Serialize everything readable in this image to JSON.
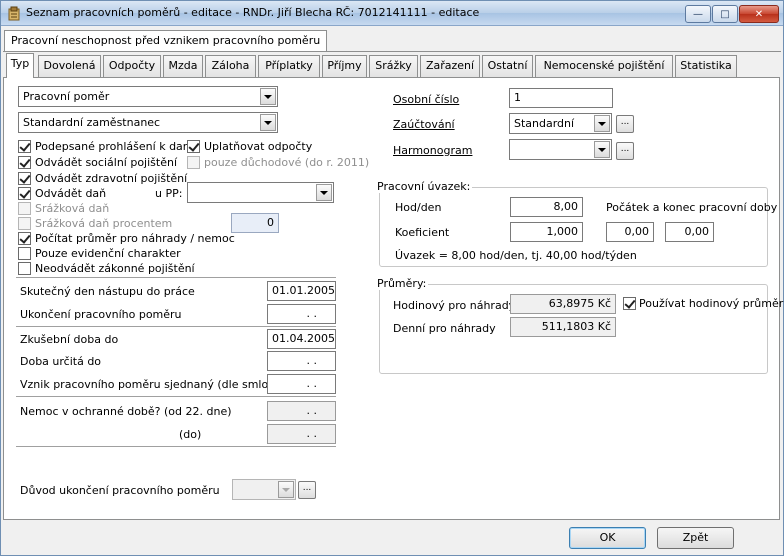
{
  "window": {
    "title": "Seznam pracovních poměrů - editace - RNDr. Jiří Blecha  RČ: 7012141111 - editace",
    "min_glyph": "—",
    "max_glyph": "□",
    "close_glyph": "✕"
  },
  "top_tab": {
    "label": "Pracovní neschopnost před vznikem pracovního poměru"
  },
  "tabs": [
    "Typ",
    "Dovolená",
    "Odpočty",
    "Mzda",
    "Záloha",
    "Příplatky",
    "Příjmy",
    "Srážky",
    "Zařazení",
    "Ostatní",
    "Nemocenské pojištění",
    "Statistika"
  ],
  "left": {
    "employment_type": "Pracovní poměr",
    "employee_type": "Standardní zaměstnanec",
    "checks": {
      "tax_declaration": {
        "label": "Podepsané prohlášení k dani",
        "checked": true
      },
      "apply_deductions": {
        "label": "Uplatňovat odpočty",
        "checked": true
      },
      "social_insurance": {
        "label": "Odvádět sociální pojištění",
        "checked": true
      },
      "pension_only": {
        "label": "pouze důchodové (do r. 2011)",
        "checked": false
      },
      "health_insurance": {
        "label": "Odvádět zdravotní pojištění",
        "checked": true
      },
      "pay_tax": {
        "label": "Odvádět daň",
        "checked": true
      },
      "withholding_tax": {
        "label": "Srážková daň",
        "checked": false
      },
      "withholding_tax_pct": {
        "label": "Srážková daň procentem",
        "checked": false
      },
      "calc_average": {
        "label": "Počítat průměr pro náhrady / nemoc",
        "checked": true
      },
      "evidence_only": {
        "label": "Pouze evidenční charakter",
        "checked": false
      },
      "no_statutory_insurance": {
        "label": "Neodvádět zákonné pojištění",
        "checked": false
      }
    },
    "pp_label": "u PP:",
    "withholding_pct_value": "0",
    "dates": {
      "start_label": "Skutečný den nástupu do práce",
      "start_value": "01.01.2005",
      "end_label": "Ukončení pracovního poměru",
      "end_value": ". .",
      "probation_label": "Zkušební doba do",
      "probation_value": "01.04.2005",
      "fixed_term_label": "Doba určitá do",
      "fixed_term_value": ". .",
      "agreed_start_label": "Vznik pracovního poměru sjednaný (dle smlouvy)",
      "agreed_start_value": ". .",
      "sick_label": "Nemoc v ochranné době? (od 22. dne)",
      "sick_from_value": ". .",
      "sick_to_label": "(do)",
      "sick_to_value": ". ."
    },
    "termination_reason_label": "Důvod ukončení pracovního poměru",
    "termination_reason_value": ""
  },
  "right": {
    "personal_no_label": "Osobní číslo",
    "personal_no_value": "1",
    "accounting_label": "Zaúčtování",
    "accounting_value": "Standardní",
    "schedule_label": "Harmonogram",
    "schedule_value": "",
    "ellipsis": "...",
    "workload": {
      "title": "Pracovní úvazek:",
      "hours_label": "Hod/den",
      "hours_value": "8,00",
      "start_end_label": "Počátek a konec pracovní doby",
      "start_value": "0,00",
      "end_value": "0,00",
      "coef_label": "Koeficient",
      "coef_value": "1,000",
      "summary": "Úvazek = 8,00 hod/den, tj. 40,00 hod/týden"
    },
    "averages": {
      "title": "Průměry:",
      "hourly_label": "Hodinový pro náhrady",
      "hourly_value": "63,8975 Kč",
      "use_hourly_label": "Používat hodinový průměr",
      "use_hourly_checked": true,
      "daily_label": "Denní pro náhrady",
      "daily_value": "511,1803 Kč"
    }
  },
  "buttons": {
    "ok": "OK",
    "back": "Zpět"
  }
}
